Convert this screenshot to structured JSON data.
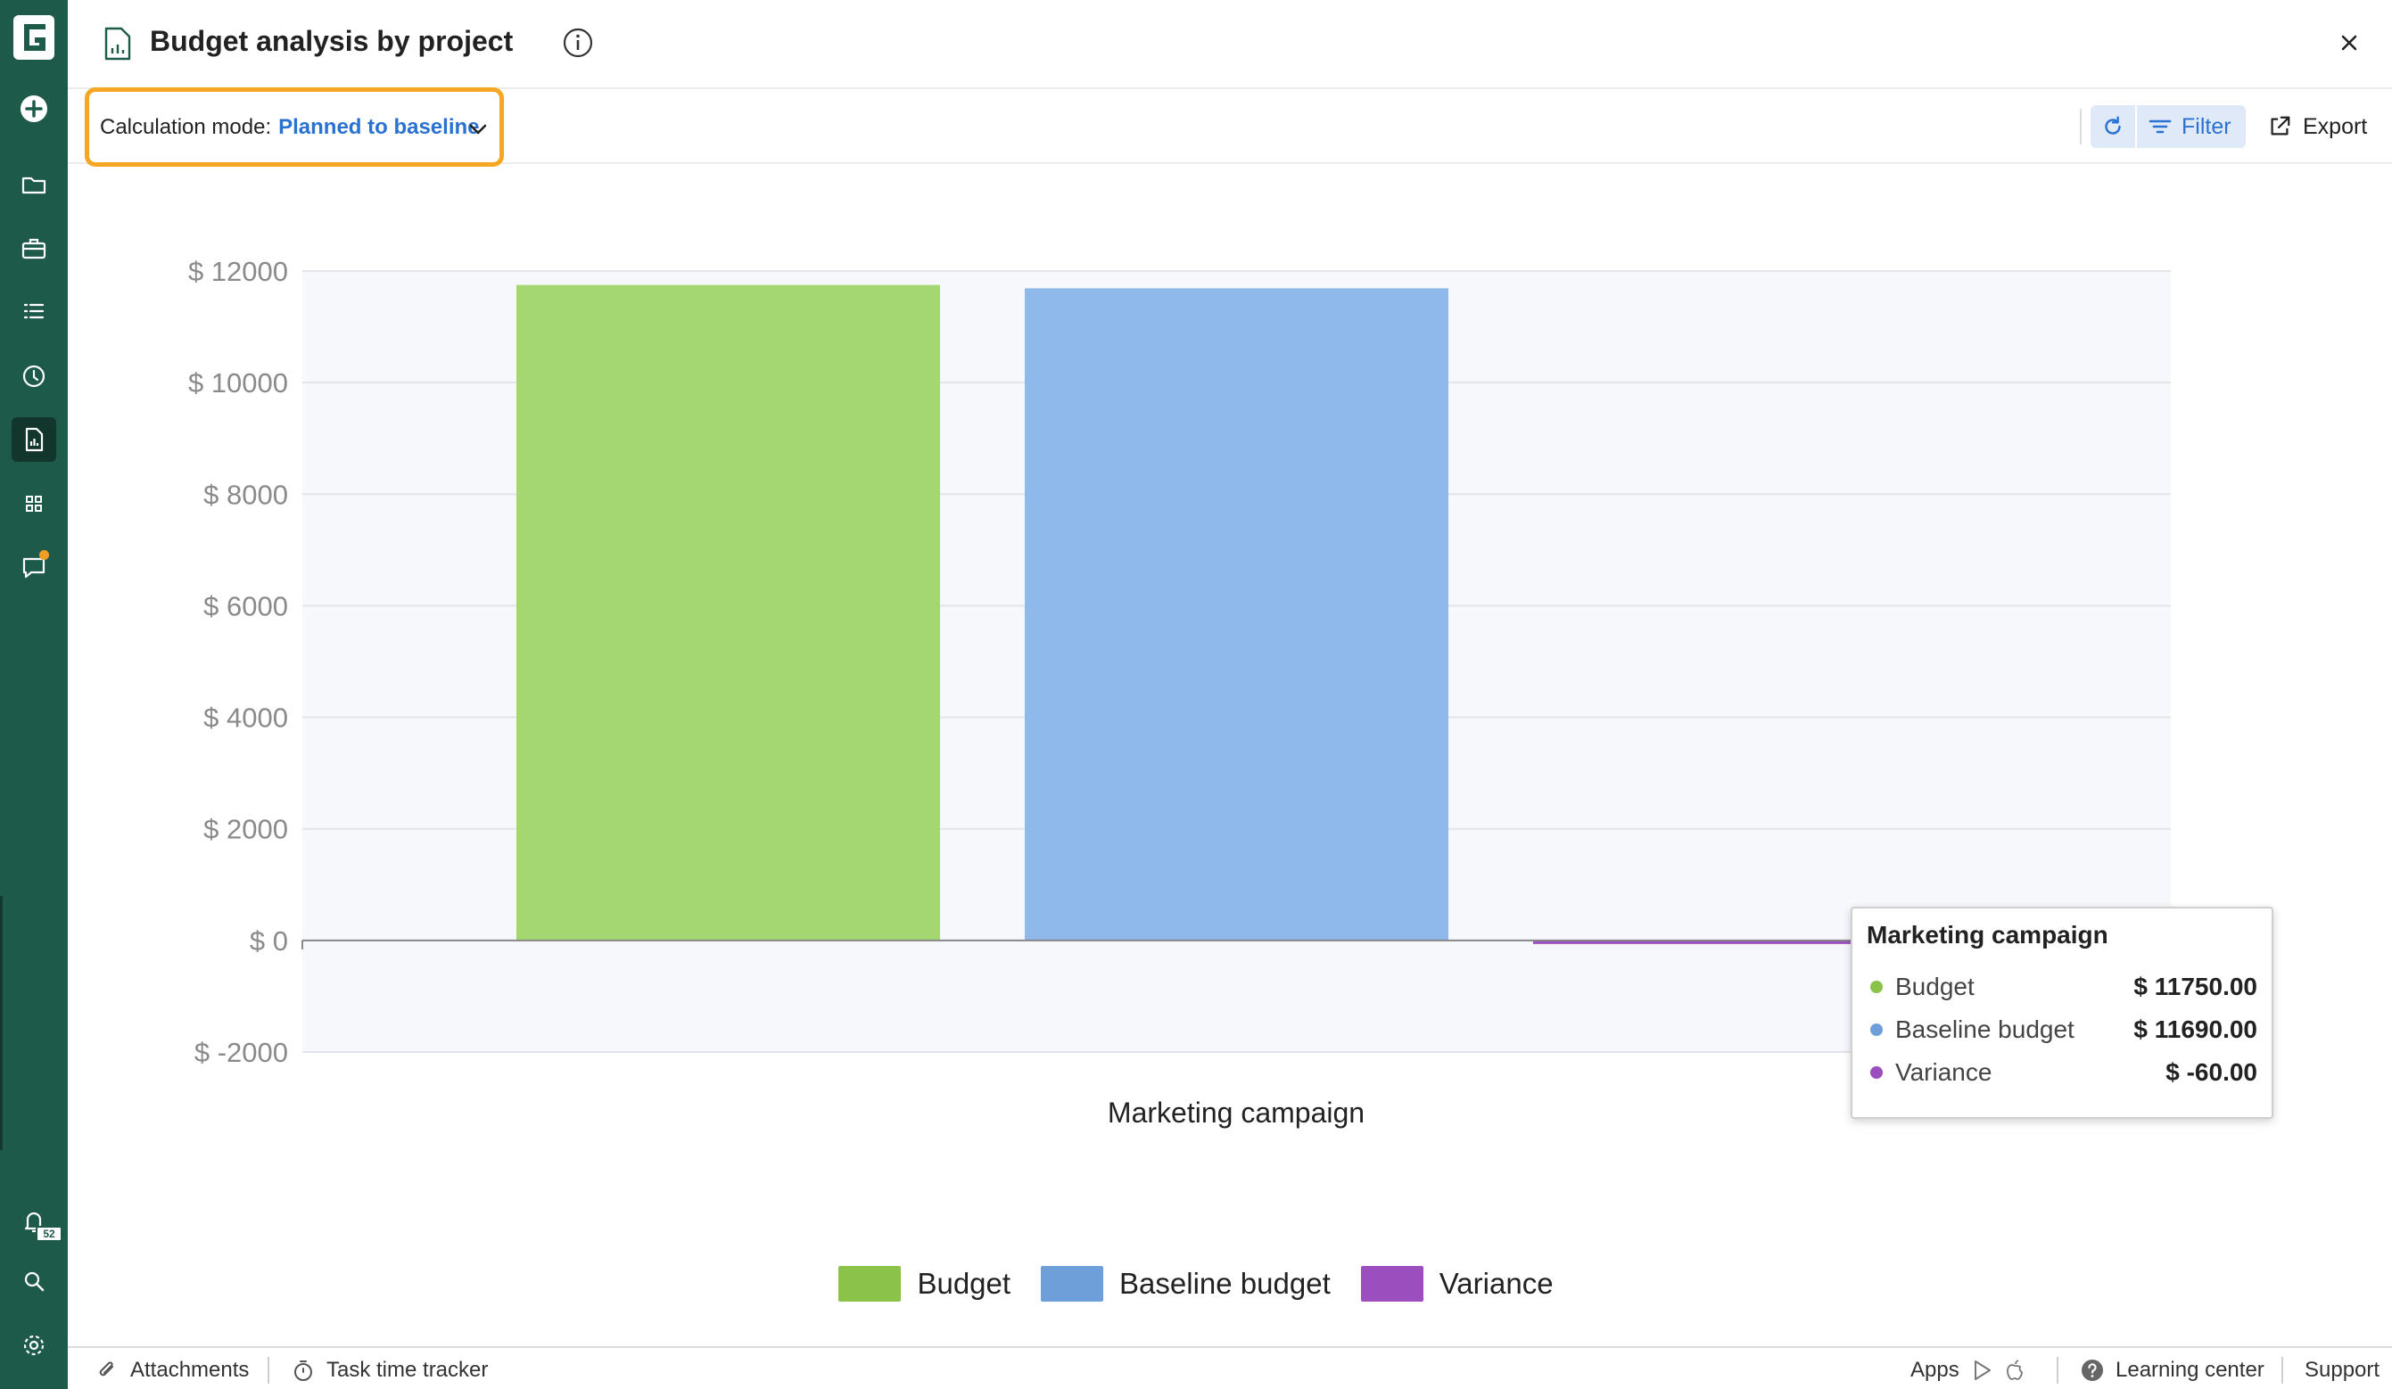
{
  "header": {
    "title": "Budget analysis by project"
  },
  "toolbar": {
    "calc_mode_label": "Calculation mode:",
    "calc_mode_value": "Planned to baseline",
    "filter_label": "Filter",
    "export_label": "Export"
  },
  "sidebar": {
    "notification_count": "52"
  },
  "colors": {
    "sidebar_bg": "#1e5a4a",
    "budget": "#a4d672",
    "baseline_budget": "#8fb8eb",
    "variance": "#9b4fbf",
    "highlight": "#f5a623",
    "accent": "#2a72d1"
  },
  "chart_data": {
    "type": "bar",
    "categories": [
      "Marketing campaign"
    ],
    "series": [
      {
        "name": "Budget",
        "values": [
          11750.0
        ],
        "color": "#a4d672"
      },
      {
        "name": "Baseline budget",
        "values": [
          11690.0
        ],
        "color": "#8fb8eb"
      },
      {
        "name": "Variance",
        "values": [
          -60.0
        ],
        "color": "#9b4fbf"
      }
    ],
    "ylim": [
      -2000,
      12000
    ],
    "yticks": [
      12000,
      10000,
      8000,
      6000,
      4000,
      2000,
      0,
      -2000
    ],
    "ytick_labels": [
      "$ 12000",
      "$ 10000",
      "$ 8000",
      "$ 6000",
      "$ 4000",
      "$ 2000",
      "$ 0",
      "$ -2000"
    ],
    "grid": true,
    "legend": "bottom-center",
    "tooltip": {
      "title": "Marketing campaign",
      "rows": [
        {
          "name": "Budget",
          "value": "$ 11750.00",
          "color": "#8bc34a"
        },
        {
          "name": "Baseline budget",
          "value": "$ 11690.00",
          "color": "#6f9fd8"
        },
        {
          "name": "Variance",
          "value": "$ -60.00",
          "color": "#9b4fbf"
        }
      ]
    }
  },
  "legend_colors": [
    "#8bc34a",
    "#6f9fd8",
    "#9b4fbf"
  ],
  "footer": {
    "attachments": "Attachments",
    "task_time_tracker": "Task time tracker",
    "apps": "Apps",
    "learning_center": "Learning center",
    "support": "Support"
  }
}
